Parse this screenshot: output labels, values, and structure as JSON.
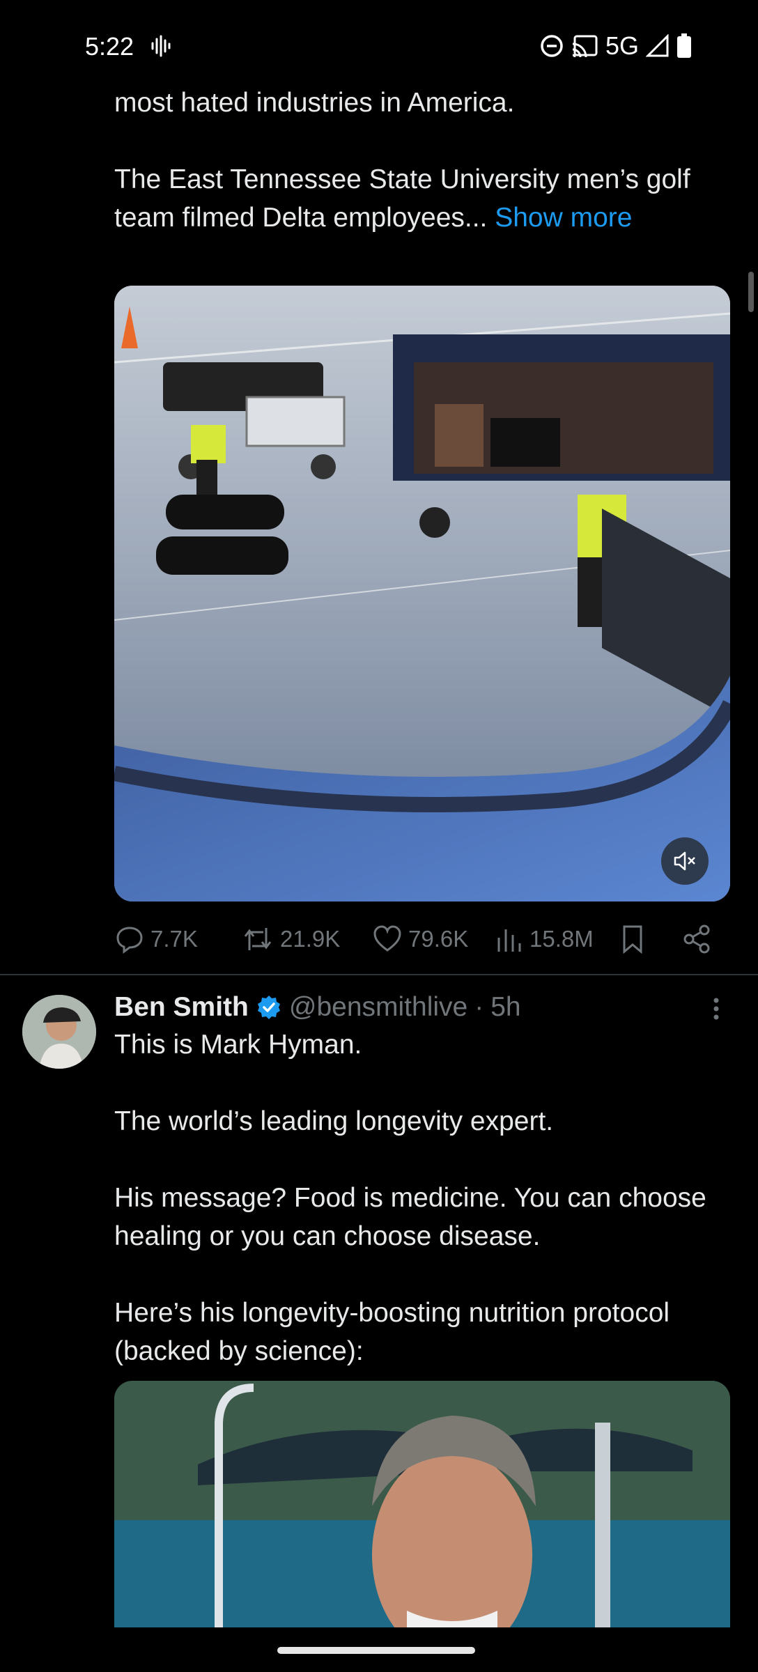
{
  "status_bar": {
    "time": "5:22",
    "network": "5G",
    "icons": [
      "sound-wave-icon",
      "do-not-disturb-icon",
      "cast-icon",
      "signal-icon",
      "battery-icon"
    ]
  },
  "tweet1": {
    "text_line0": "most hated industries in America.",
    "text_para2": "The East Tennessee State University men’s golf team filmed Delta employees... ",
    "show_more": "Show more",
    "media": {
      "type": "video",
      "muted": true
    },
    "stats": {
      "replies": "7.7K",
      "reposts": "21.9K",
      "likes": "79.6K",
      "views": "15.8M"
    }
  },
  "tweet2": {
    "author_name": "Ben Smith",
    "verified": true,
    "handle": "@bensmithlive",
    "separator": "·",
    "time": "5h",
    "text_p1": "This is Mark Hyman.",
    "text_p2": "The world’s leading longevity expert.",
    "text_p3": "His message? Food is medicine. You can choose healing or you can choose disease.",
    "text_p4": "Here’s his longevity-boosting nutrition protocol (backed by science):"
  },
  "colors": {
    "background": "#000000",
    "text": "#e7e9ea",
    "muted": "#71767b",
    "link": "#1d9bf0",
    "verified": "#1d9bf0"
  }
}
